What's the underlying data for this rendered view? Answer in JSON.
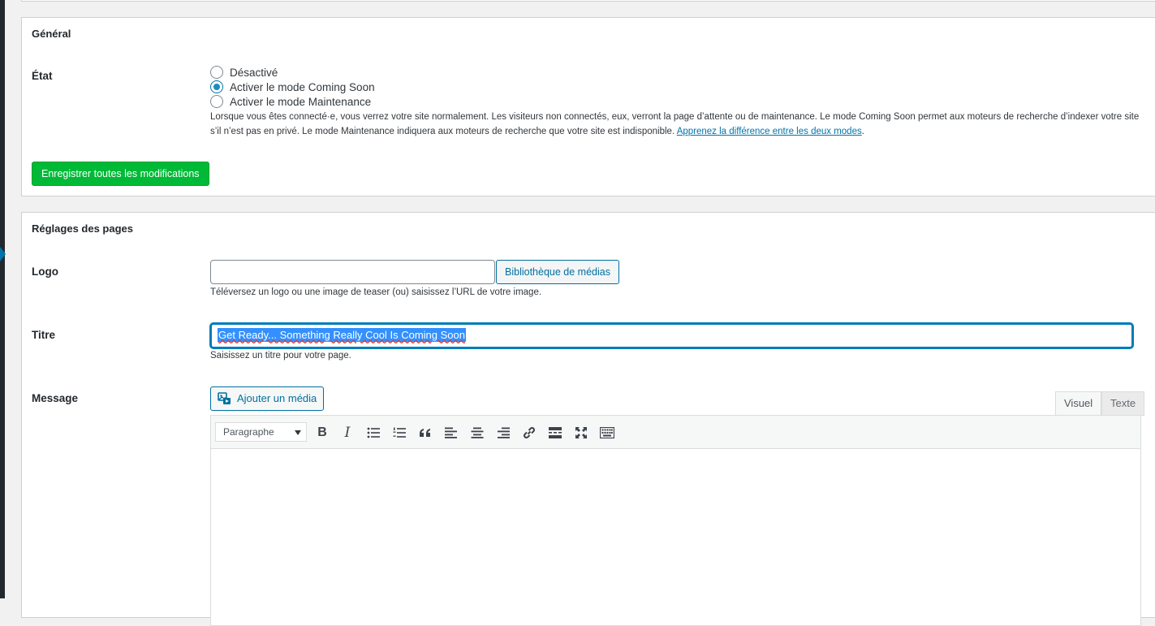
{
  "general": {
    "section_title": "Général",
    "state_label": "État",
    "options": [
      {
        "label": "Désactivé",
        "checked": false
      },
      {
        "label": "Activer le mode Coming Soon",
        "checked": true
      },
      {
        "label": "Activer le mode Maintenance",
        "checked": false
      }
    ],
    "description_line1": "Lorsque vous êtes connecté·e, vous verrez votre site normalement. Les visiteurs non connectés, eux, verront la page d’attente ou de maintenance. Le mode Coming Soon permet aux moteurs de recherche d’indexer votre site",
    "description_line2": "s’il n’est pas en privé. Le mode Maintenance indiquera aux moteurs de recherche que votre site est indisponible.",
    "description_link": "Apprenez la différence entre les deux modes",
    "description_end": ".",
    "save_button": "Enregistrer toutes les modifications"
  },
  "pages": {
    "section_title": "Réglages des pages",
    "logo": {
      "label": "Logo",
      "value": "",
      "media_button": "Bibliothèque de médias",
      "help": "Téléversez un logo ou une image de teaser (ou) saisissez l’URL de votre image."
    },
    "title": {
      "label": "Titre",
      "value": "Get Ready... Something Really Cool Is Coming Soon",
      "help": "Saisissez un titre pour votre page."
    },
    "message": {
      "label": "Message",
      "add_media_button": "Ajouter un média",
      "tab_visual": "Visuel",
      "tab_text": "Texte",
      "format_select": "Paragraphe",
      "toolbar_icons": [
        "bold-icon",
        "italic-icon",
        "bullet-list-icon",
        "numbered-list-icon",
        "blockquote-icon",
        "align-left-icon",
        "align-center-icon",
        "align-right-icon",
        "link-icon",
        "read-more-icon",
        "fullscreen-icon",
        "toolbar-toggle-icon"
      ]
    }
  },
  "colors": {
    "primary": "#0073aa",
    "save_green": "#00ba37",
    "selection": "#3390ff"
  }
}
